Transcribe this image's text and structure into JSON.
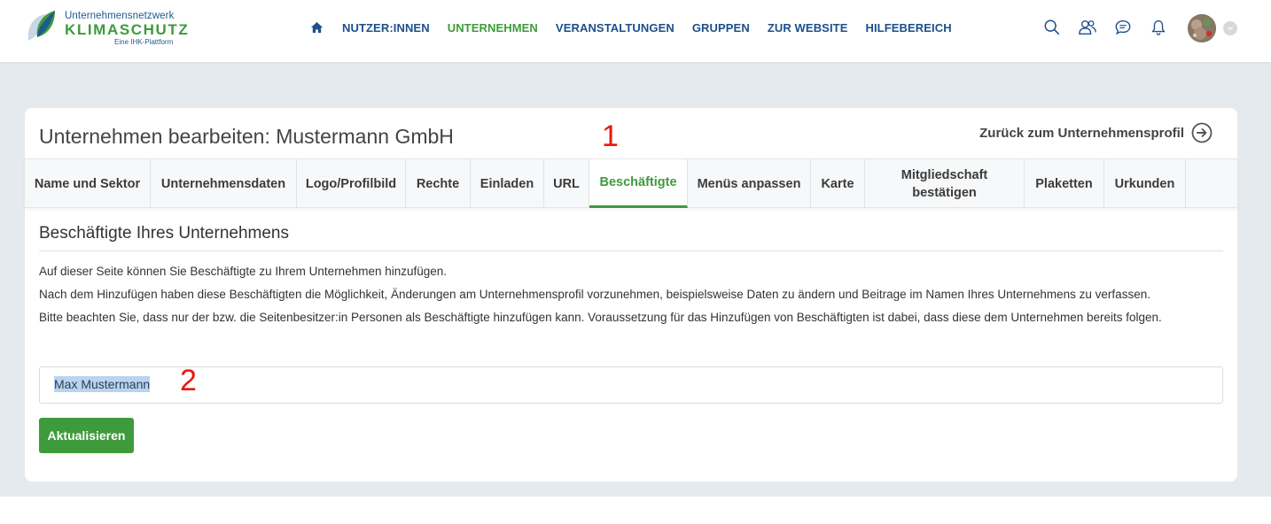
{
  "logo": {
    "line1": "Unternehmensnetzwerk",
    "line2": "KLIMASCHUTZ",
    "line3": "Eine IHK-Plattform"
  },
  "nav": {
    "items": [
      {
        "label": "NUTZER:INNEN"
      },
      {
        "label": "UNTERNEHMEN",
        "active": true
      },
      {
        "label": "VERANSTALTUNGEN"
      },
      {
        "label": "GRUPPEN"
      },
      {
        "label": "ZUR WEBSITE"
      },
      {
        "label": "HILFEBEREICH"
      }
    ],
    "colors": {
      "primary": "#1d4f8a",
      "active": "#3e9b3b"
    }
  },
  "header_icons": [
    "search-icon",
    "users-icon",
    "messages-icon",
    "bell-icon"
  ],
  "page": {
    "title": "Unternehmen bearbeiten: Mustermann GmbH",
    "back_link": "Zurück zum Unternehmensprofil"
  },
  "annotations": {
    "first": "1",
    "second": "2"
  },
  "tabs": [
    {
      "label": "Name und Sektor"
    },
    {
      "label": "Unternehmensdaten"
    },
    {
      "label": "Logo/Profilbild"
    },
    {
      "label": "Rechte"
    },
    {
      "label": "Einladen"
    },
    {
      "label": "URL"
    },
    {
      "label": "Beschäftigte",
      "active": true
    },
    {
      "label": "Menüs anpassen"
    },
    {
      "label": "Karte"
    },
    {
      "label": "Mitgliedschaft bestätigen"
    },
    {
      "label": "Plaketten"
    },
    {
      "label": "Urkunden"
    }
  ],
  "section": {
    "title": "Beschäftigte Ihres Unternehmens",
    "paragraphs": [
      "Auf dieser Seite können Sie Beschäftigte zu Ihrem Unternehmen hinzufügen.",
      "Nach dem Hinzufügen haben diese Beschäftigten die Möglichkeit, Änderungen am Unternehmensprofil vorzunehmen, beispielsweise Daten zu ändern und Beitrage im Namen Ihres Unternehmens zu verfassen.",
      "Bitte beachten Sie, dass nur der bzw. die Seitenbesitzer:in Personen als Beschäftigte hinzufügen kann. Voraussetzung für das Hinzufügen von Beschäftigten ist dabei, dass diese dem Unternehmen bereits folgen."
    ]
  },
  "employee_field": {
    "value": "Max Mustermann"
  },
  "submit_button": {
    "label": "Aktualisieren",
    "color": "#3e9b3b"
  }
}
